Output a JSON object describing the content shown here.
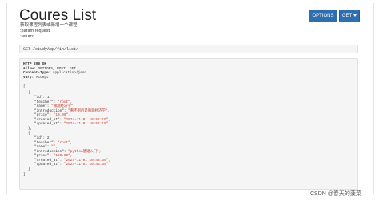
{
  "title": "Coures List",
  "buttons": {
    "options": "OPTIONS",
    "get": "GET"
  },
  "description": [
    "获取课程列表或新增一个课程",
    ":param request:",
    ":return:"
  ],
  "request": "GET /studyApp/fin/list/",
  "response": {
    "status": "HTTP 200 OK",
    "headers": [
      {
        "name": "Allow:",
        "value": "OPTIONS, POST, GET"
      },
      {
        "name": "Content-Type:",
        "value": "application/json"
      },
      {
        "name": "Vary:",
        "value": "Accept"
      }
    ],
    "open": "[",
    "items": [
      {
        "id": "1,",
        "teacher": "\"root\",",
        "name": "\"微观经济学\",",
        "introduction": "\"看不到的是微观经济学\",",
        "price": "\"10.00\",",
        "created_at": "\"2024-11-01 10:52:15\",",
        "updated_at": "\"2024-11-01 10:52:15\""
      },
      {
        "id": "2,",
        "teacher": "\"root\",",
        "name": "\"\",",
        "introduction": "\"python基础入门\",",
        "price": "\"100.00\",",
        "created_at": "\"2024-11-01 10:45:35\",",
        "updated_at": "\"2024-11-01 10:45:35\""
      }
    ],
    "close": "]",
    "keys": {
      "id": "\"id\": ",
      "teacher": "\"teacher\": ",
      "name": "\"name\": ",
      "introduction": "\"introduction\": ",
      "price": "\"price\": ",
      "created_at": "\"created_at\": ",
      "updated_at": "\"updated_at\": "
    },
    "brace_open": "{",
    "brace_close_comma": "},",
    "brace_close": "}"
  },
  "watermark": "CSDN @春天的菠菜"
}
